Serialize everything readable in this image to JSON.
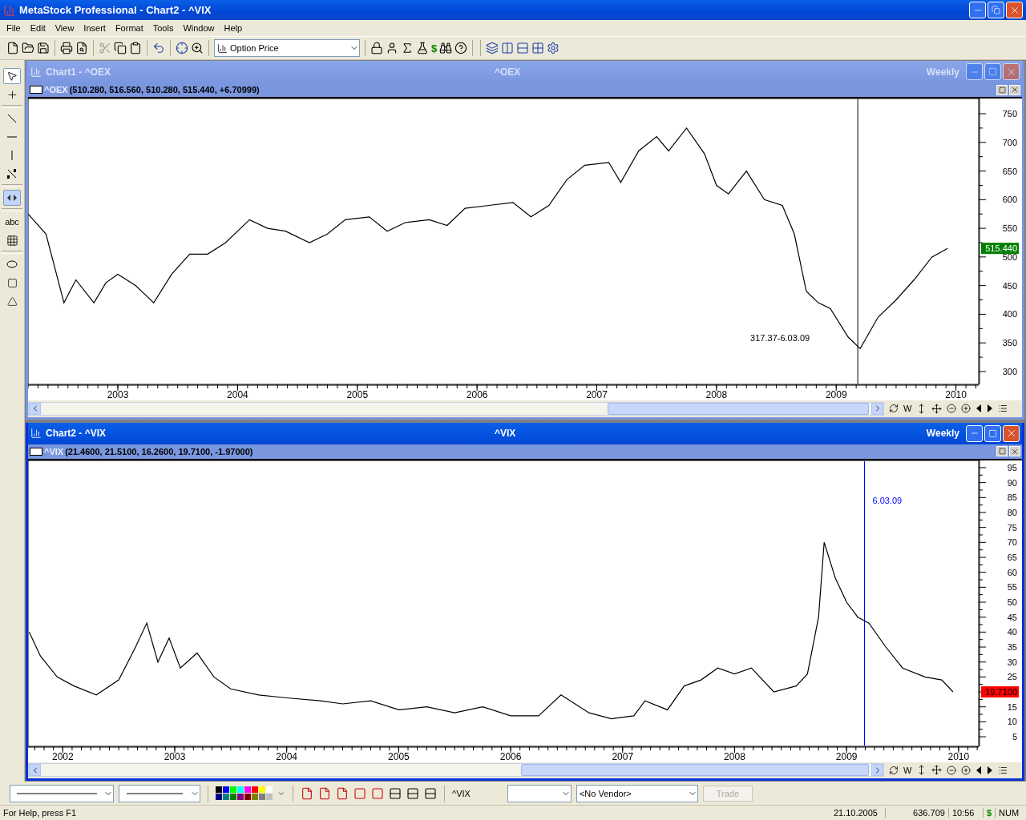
{
  "window": {
    "title": "MetaStock Professional - Chart2 - ^VIX"
  },
  "menu": [
    {
      "label": "File"
    },
    {
      "label": "Edit"
    },
    {
      "label": "View"
    },
    {
      "label": "Insert"
    },
    {
      "label": "Format"
    },
    {
      "label": "Tools"
    },
    {
      "label": "Window"
    },
    {
      "label": "Help"
    }
  ],
  "toolbar": {
    "dropdown": "Option Price",
    "dollar": "$"
  },
  "tools": [
    {
      "kind": "pointer",
      "selected": true
    },
    {
      "kind": "cross"
    },
    {
      "kind": "sep"
    },
    {
      "kind": "diagonal"
    },
    {
      "kind": "horizontal"
    },
    {
      "kind": "vertical"
    },
    {
      "kind": "regression"
    },
    {
      "kind": "sep"
    },
    {
      "kind": "arrows",
      "selected": true
    },
    {
      "kind": "sep"
    },
    {
      "kind": "text",
      "label": "abc"
    },
    {
      "kind": "grid"
    },
    {
      "kind": "sep"
    },
    {
      "kind": "ellipse"
    },
    {
      "kind": "rect"
    },
    {
      "kind": "triangle"
    }
  ],
  "charts": [
    {
      "title": "Chart1 - ^OEX",
      "symbol": "^OEX",
      "period": "Weekly",
      "active": false,
      "legend_values": "(510.280, 516.560, 510.280, 515.440, +6.70999)",
      "last_value": "515.440",
      "color": "#008000",
      "periodicity_button": "W",
      "chart_data": {
        "type": "line",
        "xlim": [
          2002.25,
          2010.19
        ],
        "ylim": [
          277.6,
          776.6
        ],
        "xticks": [
          {
            "value": 2003,
            "label": "2003"
          },
          {
            "value": 2004,
            "label": "2004"
          },
          {
            "value": 2005,
            "label": "2005"
          },
          {
            "value": 2006,
            "label": "2006"
          },
          {
            "value": 2007,
            "label": "2007"
          },
          {
            "value": 2008,
            "label": "2008"
          },
          {
            "value": 2009,
            "label": "2009"
          },
          {
            "value": 2010,
            "label": "2010"
          }
        ],
        "yticks": [
          300,
          350,
          400,
          450,
          500,
          550,
          600,
          650,
          700,
          750
        ],
        "x": [
          2002.25,
          2002.4,
          2002.55,
          2002.65,
          2002.8,
          2002.9,
          2003.0,
          2003.15,
          2003.3,
          2003.45,
          2003.6,
          2003.75,
          2003.9,
          2004.1,
          2004.25,
          2004.4,
          2004.6,
          2004.75,
          2004.9,
          2005.1,
          2005.25,
          2005.4,
          2005.6,
          2005.75,
          2005.9,
          2006.1,
          2006.3,
          2006.45,
          2006.6,
          2006.75,
          2006.9,
          2007.1,
          2007.2,
          2007.35,
          2007.5,
          2007.6,
          2007.75,
          2007.9,
          2008.0,
          2008.1,
          2008.25,
          2008.4,
          2008.55,
          2008.65,
          2008.75,
          2008.85,
          2008.95,
          2009.1,
          2009.2,
          2009.35,
          2009.5,
          2009.65,
          2009.8,
          2009.93
        ],
        "series": [
          {
            "name": "^OEX",
            "color": "#000000",
            "values": [
              575,
              540,
              420,
              460,
              420,
              455,
              470,
              450,
              420,
              470,
              505,
              505,
              525,
              565,
              550,
              545,
              525,
              540,
              565,
              570,
              545,
              560,
              565,
              555,
              585,
              590,
              595,
              570,
              590,
              635,
              660,
              665,
              630,
              685,
              710,
              685,
              725,
              680,
              625,
              610,
              650,
              600,
              590,
              540,
              440,
              420,
              410,
              360,
              340,
              395,
              425,
              460,
              500,
              515
            ]
          }
        ],
        "ref_lines": [
          {
            "axis": "x",
            "value": 2009.18,
            "color": "#000000"
          }
        ],
        "annotations": [
          "317.37-6.03.09"
        ]
      }
    },
    {
      "title": "Chart2 - ^VIX",
      "symbol": "^VIX",
      "period": "Weekly",
      "active": true,
      "legend_values": "(21.4600, 21.5100, 16.2600, 19.7100, -1.97000)",
      "last_value": "19.7100",
      "color": "#ff0000",
      "periodicity_button": "W",
      "chart_data": {
        "type": "line",
        "xlim": [
          2001.69,
          2010.18
        ],
        "ylim": [
          1.8,
          97.4
        ],
        "xticks": [
          {
            "value": 2002,
            "label": "2002"
          },
          {
            "value": 2003,
            "label": "2003"
          },
          {
            "value": 2004,
            "label": "2004"
          },
          {
            "value": 2005,
            "label": "2005"
          },
          {
            "value": 2006,
            "label": "2006"
          },
          {
            "value": 2007,
            "label": "2007"
          },
          {
            "value": 2008,
            "label": "2008"
          },
          {
            "value": 2009,
            "label": "2009"
          },
          {
            "value": 2010,
            "label": "2010"
          }
        ],
        "yticks": [
          5,
          10,
          15,
          25,
          30,
          35,
          40,
          45,
          50,
          55,
          60,
          65,
          70,
          75,
          80,
          85,
          90,
          95
        ],
        "x": [
          2001.7,
          2001.8,
          2001.95,
          2002.1,
          2002.3,
          2002.5,
          2002.65,
          2002.75,
          2002.85,
          2002.95,
          2003.05,
          2003.2,
          2003.35,
          2003.5,
          2003.75,
          2004.0,
          2004.3,
          2004.5,
          2004.75,
          2005.0,
          2005.25,
          2005.5,
          2005.75,
          2006.0,
          2006.25,
          2006.45,
          2006.7,
          2006.9,
          2007.1,
          2007.2,
          2007.4,
          2007.55,
          2007.7,
          2007.85,
          2008.0,
          2008.15,
          2008.35,
          2008.55,
          2008.65,
          2008.75,
          2008.8,
          2008.9,
          2009.0,
          2009.1,
          2009.2,
          2009.35,
          2009.5,
          2009.7,
          2009.85,
          2009.95
        ],
        "series": [
          {
            "name": "^VIX",
            "color": "#000000",
            "values": [
              40,
              32,
              25,
              22,
              19,
              24,
              35,
              43,
              30,
              38,
              28,
              33,
              25,
              21,
              19,
              18,
              17,
              16,
              17,
              14,
              15,
              13,
              15,
              12,
              12,
              19,
              13,
              11,
              12,
              17,
              14,
              22,
              24,
              28,
              26,
              28,
              20,
              22,
              26,
              45,
              70,
              58,
              50,
              45,
              43,
              35,
              28,
              25,
              24,
              20
            ]
          }
        ],
        "ref_lines": [
          {
            "axis": "x",
            "value": 2009.16,
            "color": "#0000ff"
          }
        ],
        "annotations": [
          "6.03.09"
        ]
      }
    }
  ],
  "bottom_toolbar": {
    "palette": [
      {
        "color": "#000000"
      },
      {
        "color": "#0000ff"
      },
      {
        "color": "#00ff00"
      },
      {
        "color": "#00ffff"
      },
      {
        "color": "#ff00ff"
      },
      {
        "color": "#ff0000"
      },
      {
        "color": "#ffff00"
      },
      {
        "color": "#ffffff"
      },
      {
        "color": "#000080"
      },
      {
        "color": "#008080"
      },
      {
        "color": "#008000"
      },
      {
        "color": "#800080"
      },
      {
        "color": "#800000"
      },
      {
        "color": "#808000"
      },
      {
        "color": "#808080"
      },
      {
        "color": "#c0c0c0"
      }
    ],
    "symbol": "^VIX",
    "vendor": "<No Vendor>",
    "trade": {
      "label": "Trade",
      "disabled": true
    }
  },
  "status_bar": {
    "help": "For Help, press F1",
    "date": "21.10.2005",
    "value": "636.709",
    "time": "10:56",
    "dollar": "$",
    "num": "NUM"
  }
}
